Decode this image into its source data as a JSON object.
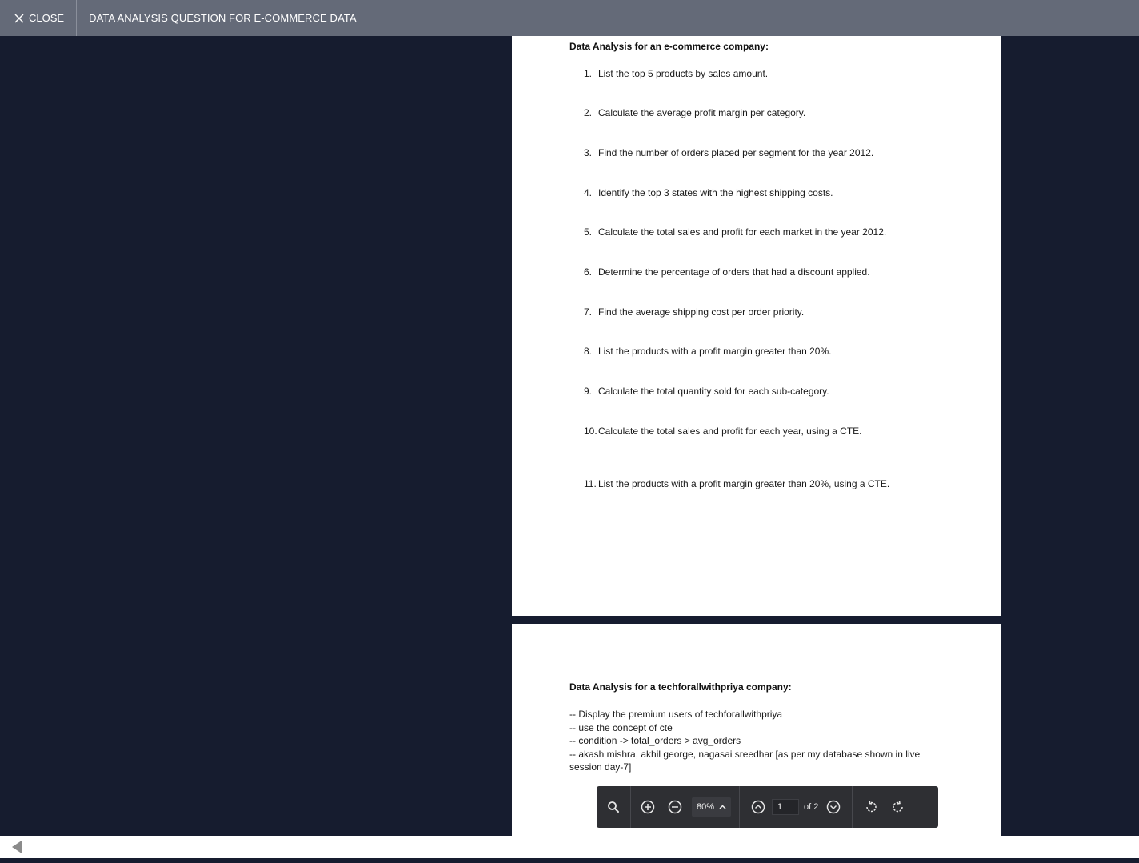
{
  "header": {
    "close_label": "CLOSE",
    "document_title": "DATA ANALYSIS QUESTION FOR E-COMMERCE DATA"
  },
  "page1": {
    "heading": "Data Analysis for an e-commerce company:",
    "questions": [
      {
        "num": "1.",
        "text": "List the top 5 products by sales amount."
      },
      {
        "num": "2.",
        "text": "Calculate the average profit margin per category."
      },
      {
        "num": "3.",
        "text": "Find the number of orders placed per segment for the year 2012."
      },
      {
        "num": "4.",
        "text": "Identify the top 3 states with the highest shipping costs."
      },
      {
        "num": "5.",
        "text": "Calculate the total sales and profit for each market in the year 2012."
      },
      {
        "num": "6.",
        "text": "Determine the percentage of orders that had a discount applied."
      },
      {
        "num": "7.",
        "text": "Find the average shipping cost per order priority."
      },
      {
        "num": "8.",
        "text": "List the products with a profit margin greater than 20%."
      },
      {
        "num": "9.",
        "text": "Calculate the total quantity sold for each sub-category."
      },
      {
        "num": "10.",
        "text": "Calculate the total sales and profit for each year, using a CTE."
      },
      {
        "num": "11.",
        "text": "List the products with a profit margin greater than 20%, using a CTE."
      }
    ]
  },
  "page2": {
    "heading": "Data Analysis for a techforallwithpriya company:",
    "lines": [
      "-- Display the premium users of techforallwithpriya",
      "-- use the concept of cte",
      "-- condition -> total_orders > avg_orders",
      "-- akash mishra, akhil george, nagasai sreedhar [as per my database shown in live session day-7]"
    ]
  },
  "toolbar": {
    "zoom_value": "80%",
    "page_current": "1",
    "page_total_label": "of 2",
    "icons": [
      "search-icon",
      "zoom-in-icon",
      "zoom-out-icon",
      "chevron-up-icon",
      "page-up-icon",
      "page-down-icon",
      "rotate-left-icon",
      "rotate-right-icon"
    ]
  },
  "colors": {
    "header_bg": "#646a78",
    "viewer_bg": "#161c2f",
    "toolbar_bg": "#2e2f33",
    "page_bg": "#ffffff"
  }
}
